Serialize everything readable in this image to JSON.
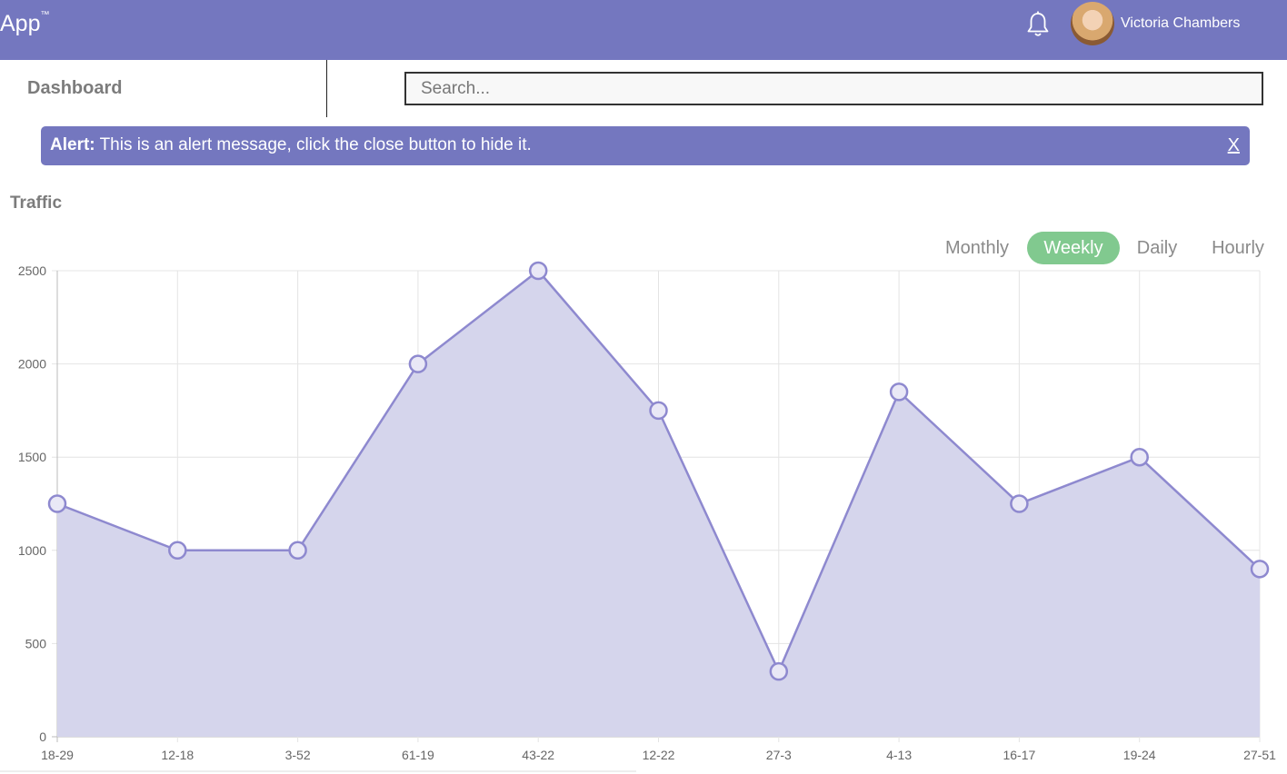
{
  "header": {
    "app_name": "App",
    "app_mark": "™",
    "user_name": "Victoria Chambers",
    "icons": [
      "bell-icon",
      "avatar"
    ]
  },
  "nav": {
    "dashboard_label": "Dashboard"
  },
  "search": {
    "placeholder": "Search..."
  },
  "alert": {
    "label": "Alert:",
    "message": "This is an alert message, click the close button to hide it.",
    "close_label": "X"
  },
  "traffic": {
    "title": "Traffic",
    "tabs": [
      "Monthly",
      "Weekly",
      "Daily",
      "Hourly"
    ],
    "active_tab": "Weekly"
  },
  "colors": {
    "brand": "#7477bf",
    "active_tab": "#81c98f",
    "line": "#8e89cf",
    "fill": "#d5d5ec"
  },
  "chart_data": {
    "type": "area",
    "categories": [
      "18-29",
      "12-18",
      "3-52",
      "61-19",
      "43-22",
      "12-22",
      "27-3",
      "4-13",
      "16-17",
      "19-24",
      "27-51"
    ],
    "values": [
      1250,
      1000,
      1000,
      2000,
      2500,
      1750,
      350,
      1850,
      1250,
      1500,
      900
    ],
    "yticks": [
      0,
      500,
      1000,
      1500,
      2000,
      2500
    ],
    "ylim": [
      0,
      2500
    ],
    "grid": true
  }
}
